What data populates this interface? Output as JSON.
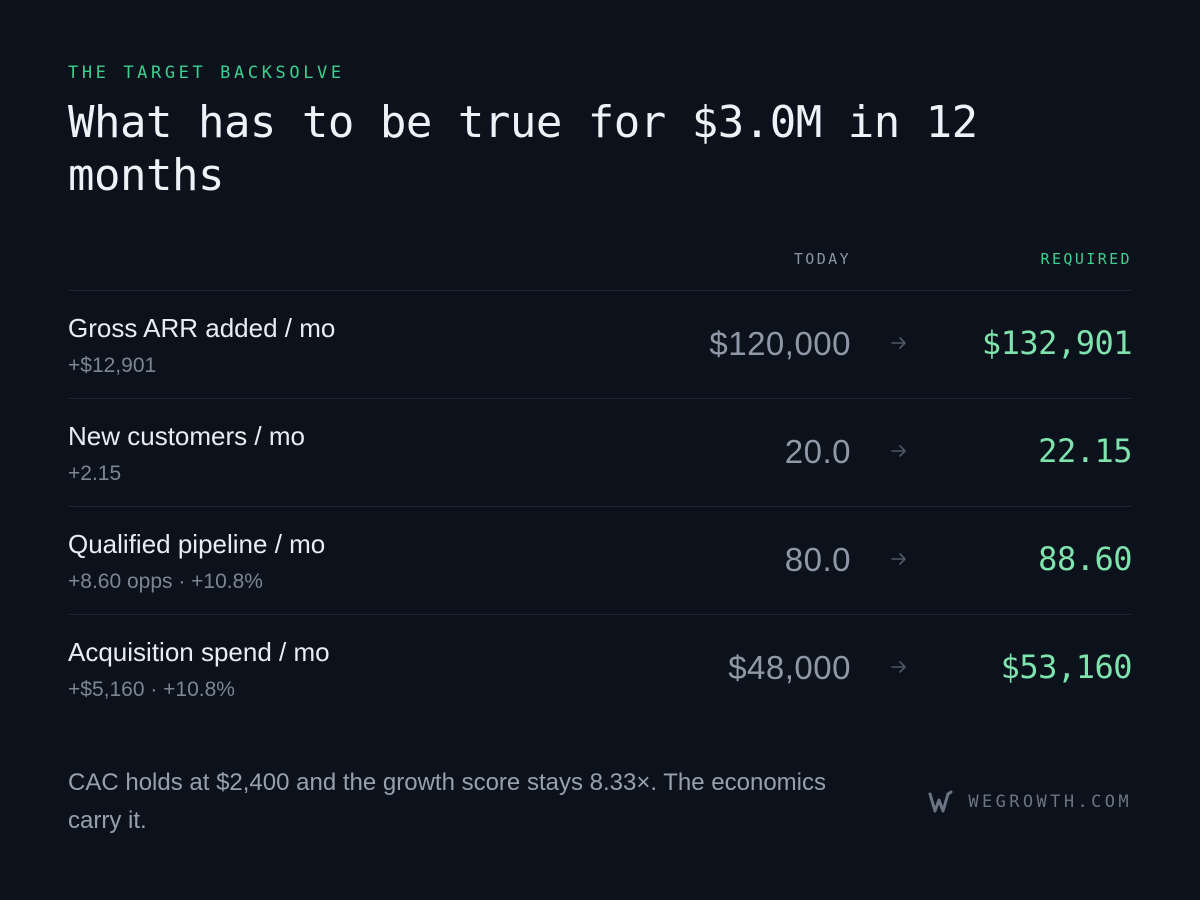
{
  "header": {
    "eyebrow": "THE TARGET BACKSOLVE",
    "title": "What has to be true for $3.0M in 12 months"
  },
  "columns": {
    "today": "TODAY",
    "required": "REQUIRED"
  },
  "rows": [
    {
      "label": "Gross ARR added / mo",
      "delta": "+$12,901",
      "today": "$120,000",
      "required": "$132,901"
    },
    {
      "label": "New customers / mo",
      "delta": "+2.15",
      "today": "20.0",
      "required": "22.15"
    },
    {
      "label": "Qualified pipeline / mo",
      "delta": "+8.60 opps · +10.8%",
      "today": "80.0",
      "required": "88.60"
    },
    {
      "label": "Acquisition spend / mo",
      "delta": "+$5,160 · +10.8%",
      "today": "$48,000",
      "required": "$53,160"
    }
  ],
  "footnote": "CAC holds at $2,400 and the growth score stays 8.33×. The economics carry it.",
  "brand": {
    "name": "WEGROWTH.COM",
    "icon": "w-logo-icon"
  },
  "colors": {
    "background": "#0c121c",
    "accent": "#3ecf8e",
    "required_value": "#7ee3ad",
    "muted": "#8f98a6"
  }
}
